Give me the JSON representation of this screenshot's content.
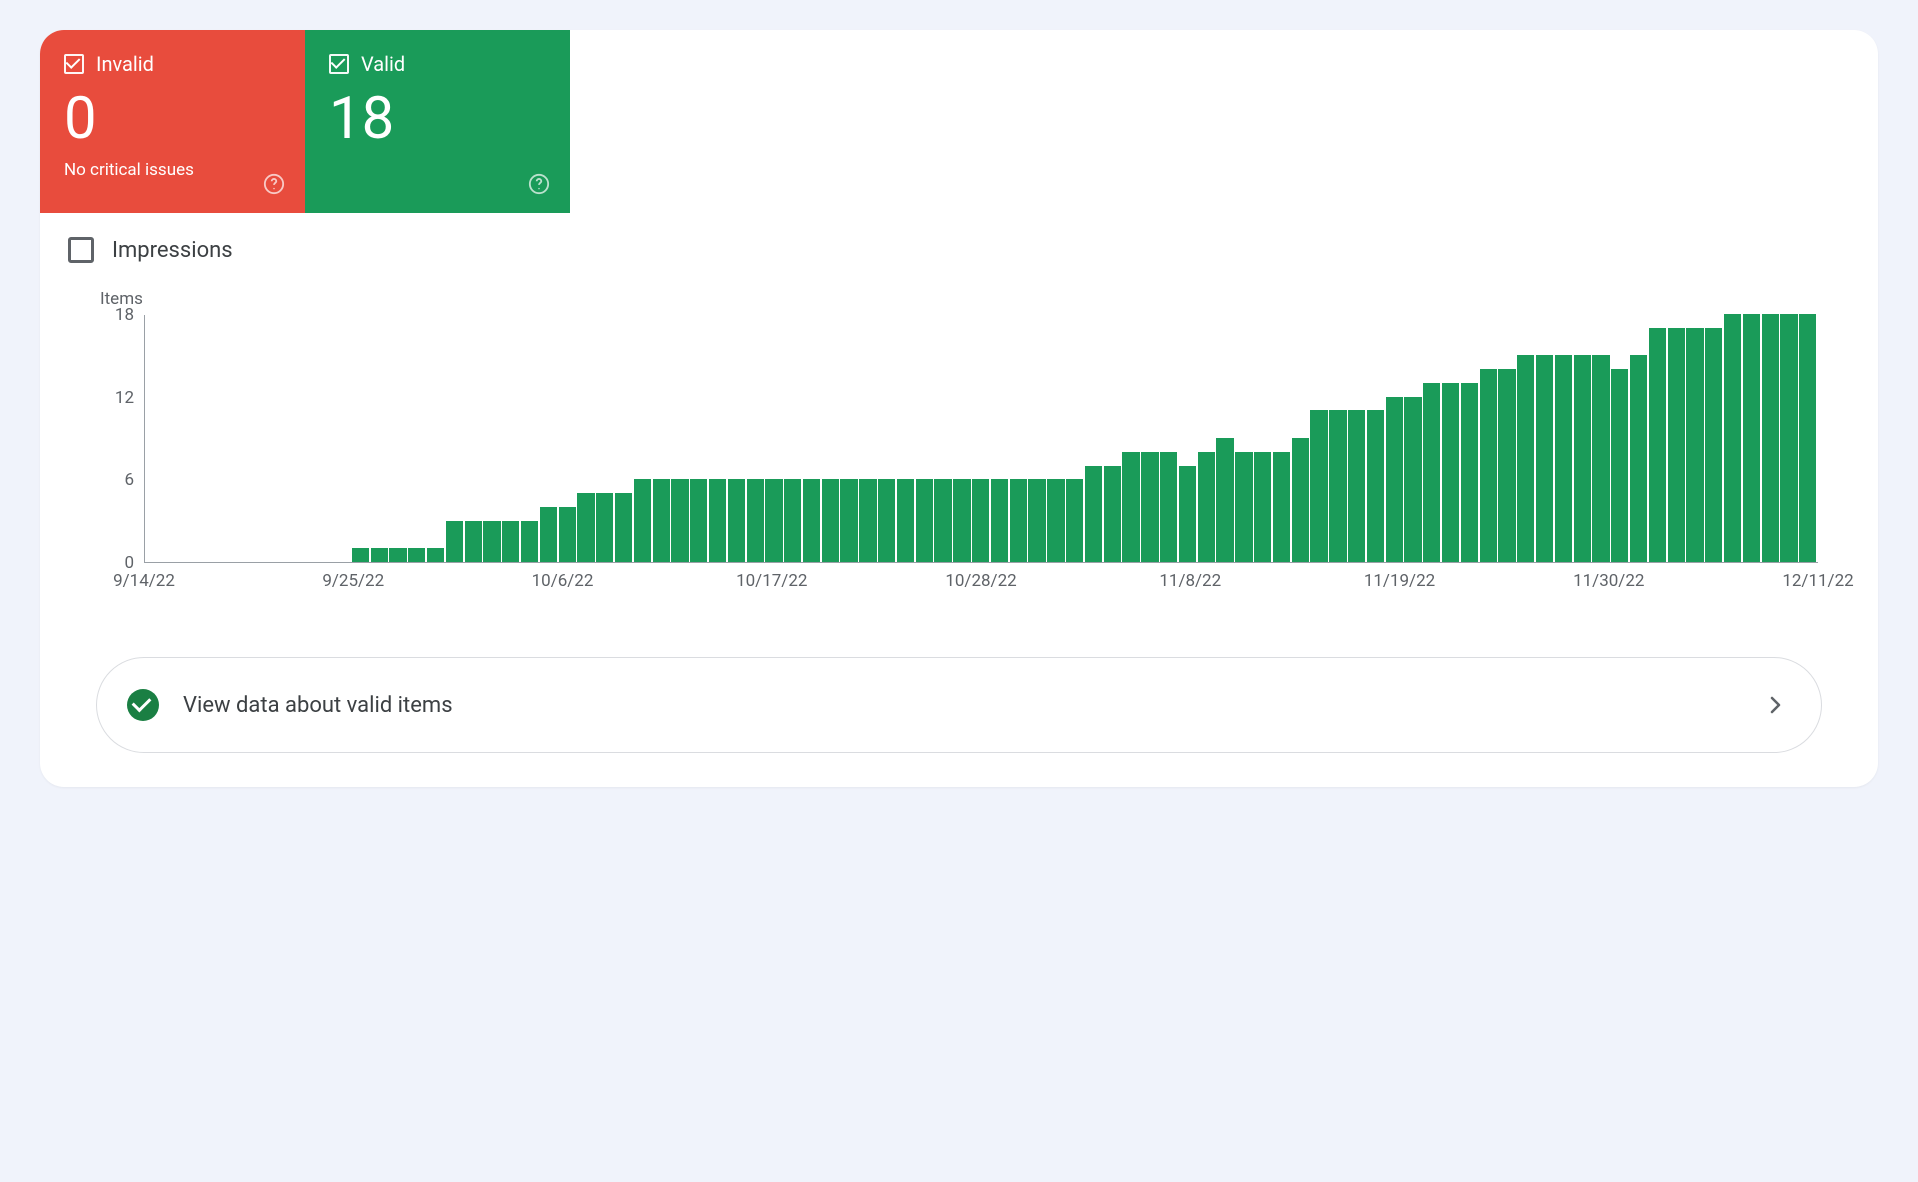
{
  "cards": {
    "invalid": {
      "label": "Invalid",
      "value": "0",
      "sub": "No critical issues"
    },
    "valid": {
      "label": "Valid",
      "value": "18",
      "sub": ""
    }
  },
  "impressions": {
    "label": "Impressions"
  },
  "cta": {
    "label": "View data about valid items"
  },
  "chart_data": {
    "type": "bar",
    "title": "Items",
    "xlabel": "",
    "ylabel": "Items",
    "ylim": [
      0,
      18
    ],
    "y_ticks": [
      0,
      6,
      12,
      18
    ],
    "x_tick_labels": [
      "9/14/22",
      "9/25/22",
      "10/6/22",
      "10/17/22",
      "10/28/22",
      "11/8/22",
      "11/19/22",
      "11/30/22",
      "12/11/22"
    ],
    "x_tick_indices": [
      0,
      11,
      22,
      33,
      44,
      55,
      66,
      77,
      88
    ],
    "values": [
      0,
      0,
      0,
      0,
      0,
      0,
      0,
      0,
      0,
      0,
      0,
      1,
      1,
      1,
      1,
      1,
      3,
      3,
      3,
      3,
      3,
      4,
      4,
      5,
      5,
      5,
      6,
      6,
      6,
      6,
      6,
      6,
      6,
      6,
      6,
      6,
      6,
      6,
      6,
      6,
      6,
      6,
      6,
      6,
      6,
      6,
      6,
      6,
      6,
      6,
      7,
      7,
      8,
      8,
      8,
      7,
      8,
      9,
      8,
      8,
      8,
      9,
      11,
      11,
      11,
      11,
      12,
      12,
      13,
      13,
      13,
      14,
      14,
      15,
      15,
      15,
      15,
      15,
      14,
      15,
      17,
      17,
      17,
      17,
      18,
      18,
      18,
      18,
      18
    ],
    "colors": {
      "valid": "#1a9b59",
      "invalid": "#e84c3d"
    }
  }
}
